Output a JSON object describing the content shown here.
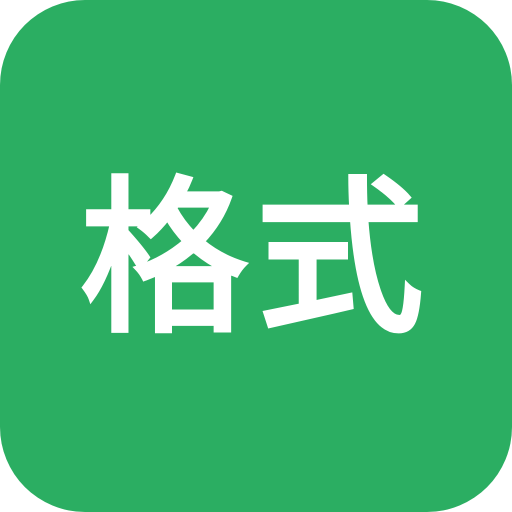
{
  "icon": {
    "label": "格式",
    "background_color": "#2BAE62",
    "text_color": "#FFFFFF"
  }
}
